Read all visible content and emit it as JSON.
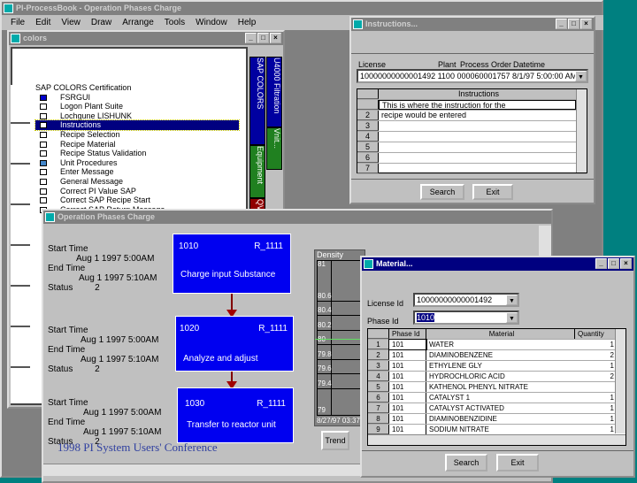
{
  "app": {
    "title": "PI-ProcessBook - Operation Phases Charge",
    "menu": [
      "File",
      "Edit",
      "View",
      "Draw",
      "Arrange",
      "Tools",
      "Window",
      "Help"
    ]
  },
  "colors_window": {
    "title": "colors",
    "header": "SAP COLORS Certification",
    "items": [
      "FSRGUI",
      "Logon Plant Suite",
      "Lochgune LISHUNK",
      "Instructions",
      "Recipe Selection",
      "Recipe Material",
      "Recipe Status Validation",
      "Unit Procedures",
      "Enter Message",
      "General Message",
      "Correct PI Value SAP",
      "Correct SAP Recipe Start",
      "Correct SAP Return Message"
    ],
    "selected": "Instructions",
    "tabs": [
      "SAP COLORS",
      "Equipment",
      "QV",
      "U4000 Filtration",
      "Vnit..."
    ]
  },
  "instructions_window": {
    "title": "Instructions...",
    "labels": [
      "License",
      "Plant",
      "Process Order",
      "Datetime"
    ],
    "combo_value": "10000000000001492   1100   000060001757   8/1/97 5:00:00 AM",
    "grid_header": "Instructions",
    "rows": [
      {
        "n": "",
        "text": "This is where the instruction for the"
      },
      {
        "n": "2",
        "text": "recipe would be entered"
      },
      {
        "n": "3",
        "text": ""
      },
      {
        "n": "4",
        "text": ""
      },
      {
        "n": "5",
        "text": ""
      },
      {
        "n": "6",
        "text": ""
      },
      {
        "n": "7",
        "text": ""
      }
    ],
    "search": "Search",
    "exit": "Exit"
  },
  "opc_window": {
    "title": "Operation Phases Charge",
    "phases": [
      {
        "start_label": "Start Time",
        "start": "Aug 1 1997 5:00AM",
        "end_label": "End Time",
        "end": "Aug 1 1997 5:10AM",
        "status_label": "Status",
        "status": "2",
        "id": "1010",
        "unit": "R_1111",
        "desc": "Charge input Substance"
      },
      {
        "start_label": "Start Time",
        "start": "Aug 1 1997 5:00AM",
        "end_label": "End Time",
        "end": "Aug 1 1997 5:10AM",
        "status_label": "Status",
        "status": "2",
        "id": "1020",
        "unit": "R_1111",
        "desc": "Analyze and adjust"
      },
      {
        "start_label": "Start Time",
        "start": "Aug 1 1997 5:00AM",
        "end_label": "End Time",
        "end": "Aug 1 1997 5:10AM",
        "status_label": "Status",
        "status": "2",
        "id": "1030",
        "unit": "R_1111",
        "desc": "Transfer to reactor unit"
      }
    ],
    "trend": {
      "title": "Density",
      "ticks": [
        "81",
        "80.6",
        "80.4",
        "80.2",
        "80",
        "79.8",
        "79.6",
        "79.4",
        "79"
      ],
      "time": "8/27/97 03:37",
      "button": "Trend"
    }
  },
  "footer": "1998 PI System Users' Conference",
  "material_window": {
    "title": "Material...",
    "license_label": "License Id",
    "license_value": "10000000000001492",
    "phase_label": "Phase Id",
    "phase_value": "1010",
    "columns": [
      "Phase Id",
      "Material",
      "Quantity"
    ],
    "rows": [
      {
        "n": "1",
        "phase": "101",
        "material": "WATER",
        "qty": "1"
      },
      {
        "n": "2",
        "phase": "101",
        "material": "DIAMINOBENZENE",
        "qty": "2"
      },
      {
        "n": "3",
        "phase": "101",
        "material": "ETHYLENE GLY",
        "qty": "1"
      },
      {
        "n": "4",
        "phase": "101",
        "material": "HYDROCHLORIC ACID",
        "qty": "2"
      },
      {
        "n": "5",
        "phase": "101",
        "material": "KATHENOL PHENYL NITRATE",
        "qty": ""
      },
      {
        "n": "6",
        "phase": "101",
        "material": "CATALYST 1",
        "qty": "1"
      },
      {
        "n": "7",
        "phase": "101",
        "material": "CATALYST ACTIVATED",
        "qty": "1"
      },
      {
        "n": "8",
        "phase": "101",
        "material": "DIAMINOBENZIDINE",
        "qty": "1"
      },
      {
        "n": "9",
        "phase": "101",
        "material": "SODIUM NITRATE",
        "qty": "1"
      }
    ],
    "search": "Search",
    "exit": "Exit"
  }
}
